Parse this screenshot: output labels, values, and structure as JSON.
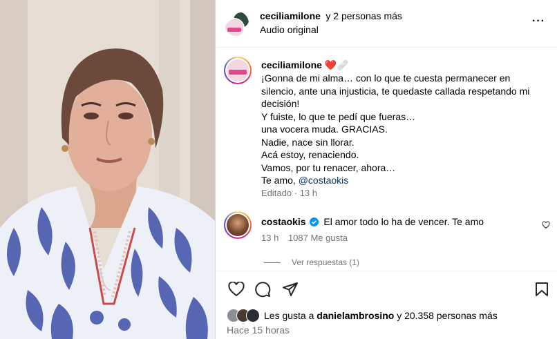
{
  "header": {
    "username": "ceciliamilone",
    "others": "y 2 personas más",
    "audio": "Audio original",
    "more": "···"
  },
  "post": {
    "username": "ceciliamilone",
    "emoji": "❤️🩹",
    "caption_lines": [
      "¡Gonna de mi alma… con lo que te cuesta permanecer en",
      "silencio, ante una injusticia, te quedaste callada respetando mi",
      "decisión!",
      "Y fuiste, lo que te pedí que fueras…",
      "una vocera muda. GRACIAS.",
      "Nadie, nace sin llorar.",
      "Acá estoy, renaciendo.",
      "Vamos, por tu renacer, ahora…"
    ],
    "last_line_prefix": "Te amo, ",
    "mention": "@costaokis",
    "edited": "Editado",
    "dot": "·",
    "time": "13 h"
  },
  "comment": {
    "username": "costaokis",
    "text": "El amor todo lo ha de vencer. Te amo",
    "time": "13 h",
    "likes": "1087 Me gusta",
    "replies": "Ver respuestas (1)"
  },
  "likes": {
    "prefix": "Les gusta a ",
    "user": "danielambrosino",
    "suffix": " y 20.358 personas más"
  },
  "posted": "Hace 15 horas",
  "colors": {
    "verified": "#0095f6",
    "link": "#00376b",
    "heart": "#e0245e"
  }
}
